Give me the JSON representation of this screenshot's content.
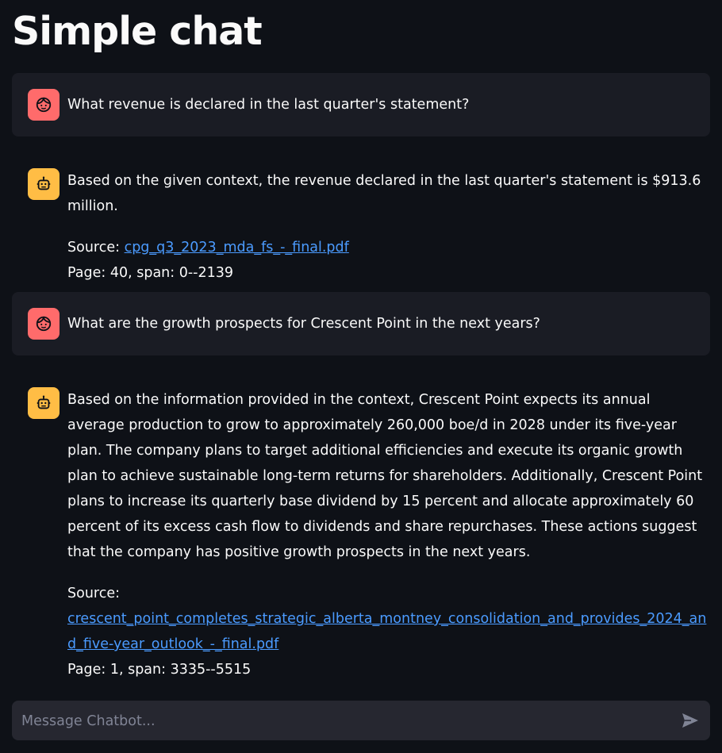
{
  "page": {
    "title": "Simple chat"
  },
  "messages": [
    {
      "role": "user",
      "avatar_icon": "user-face-icon",
      "text": "What revenue is declared in the last quarter's statement?"
    },
    {
      "role": "assistant",
      "avatar_icon": "bot-icon",
      "text": "Based on the given context, the revenue declared in the last quarter's statement is $913.6 million.",
      "source_label": "Source: ",
      "source_link": "cpg_q3_2023_mda_fs_-_final.pdf",
      "page_info": "Page: 40, span: 0--2139"
    },
    {
      "role": "user",
      "avatar_icon": "user-face-icon",
      "text": "What are the growth prospects for Crescent Point in the next years?"
    },
    {
      "role": "assistant",
      "avatar_icon": "bot-icon",
      "text": "Based on the information provided in the context, Crescent Point expects its annual average production to grow to approximately 260,000 boe/d in 2028 under its five-year plan. The company plans to target additional efficiencies and execute its organic growth plan to achieve sustainable long-term returns for shareholders. Additionally, Crescent Point plans to increase its quarterly base dividend by 15 percent and allocate approximately 60 percent of its excess cash flow to dividends and share repurchases. These actions suggest that the company has positive growth prospects in the next years.",
      "source_label": "Source:",
      "source_link": "crescent_point_completes_strategic_alberta_montney_consolidation_and_provides_2024_and_five-year_outlook_-_final.pdf",
      "page_info": "Page: 1, span: 3335--5515"
    }
  ],
  "chat_input": {
    "placeholder": "Message Chatbot...",
    "value": "",
    "send_icon": "send-icon"
  },
  "colors": {
    "background": "#0e1117",
    "user_bubble": "#1a1c24",
    "user_avatar": "#ff6b6b",
    "bot_avatar": "#ffbd45",
    "link": "#4b9bff",
    "input_bg": "#262730"
  }
}
